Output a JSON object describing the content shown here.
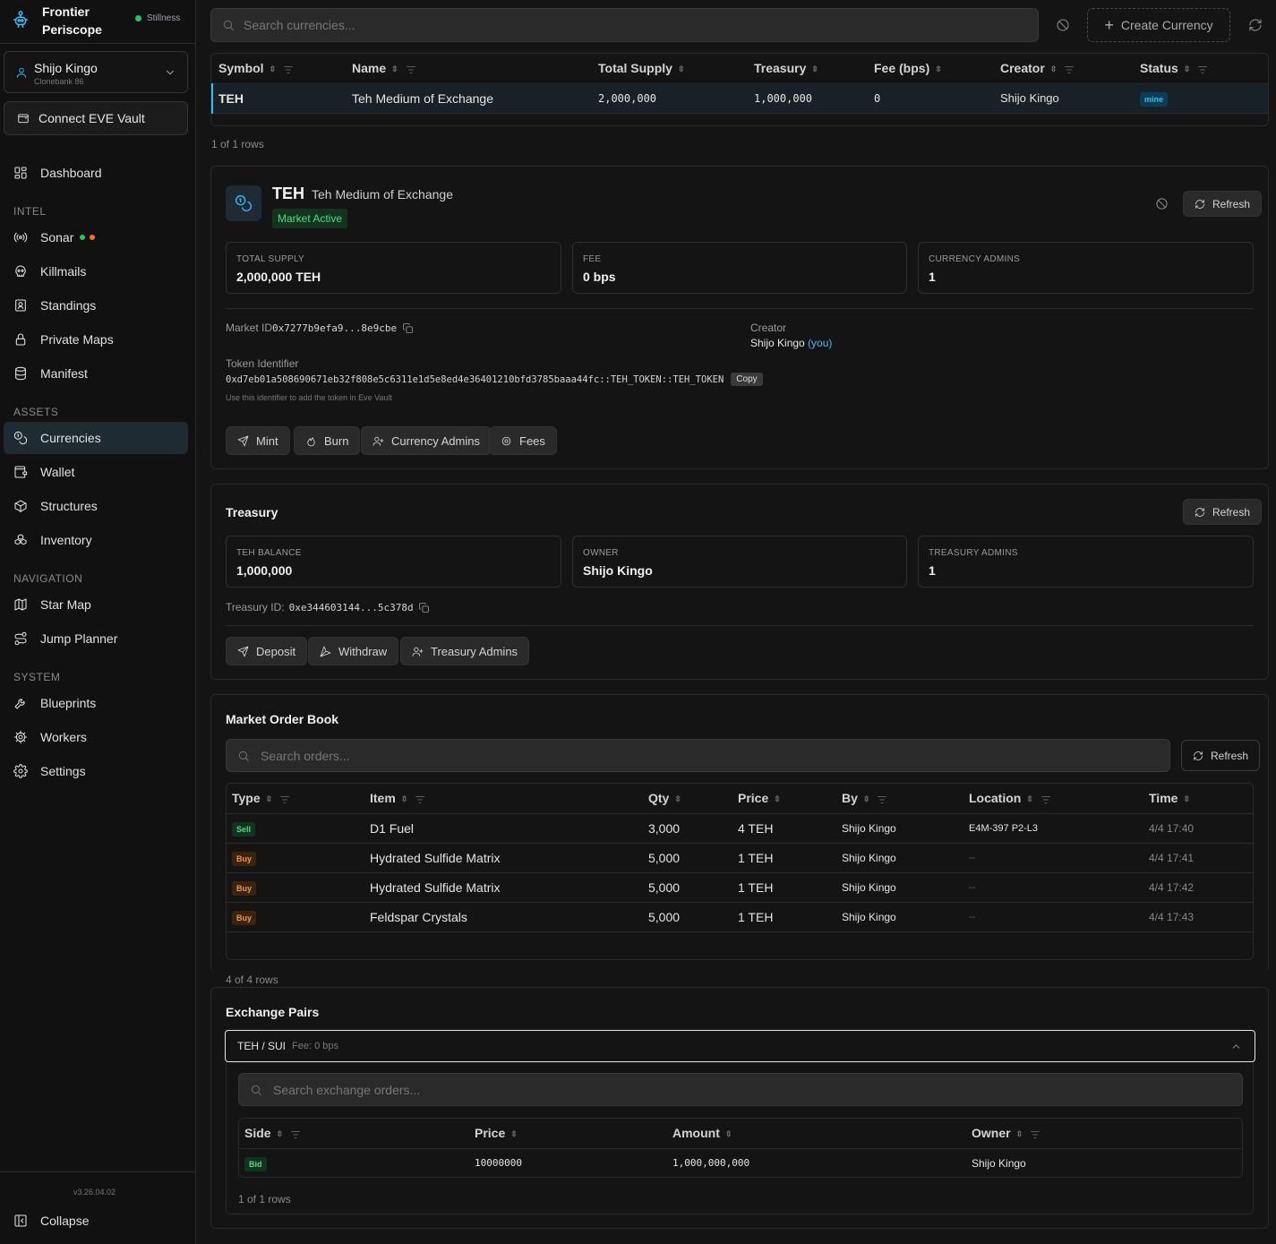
{
  "app": {
    "title": "Frontier Periscope",
    "server": "Stillness",
    "version": "v3.26.04.02"
  },
  "colors": {
    "accent": "#38bdf8",
    "green": "#22c55e",
    "orange": "#f97316",
    "sell": "#4ade80",
    "buy": "#fb923c"
  },
  "user": {
    "name": "Shijo Kingo",
    "sub": "Clonebank 86"
  },
  "vault_label": "Connect EVE Vault",
  "nav": {
    "dashboard": "Dashboard",
    "intel_header": "INTEL",
    "sonar": "Sonar",
    "killmails": "Killmails",
    "standings": "Standings",
    "private_maps": "Private Maps",
    "manifest": "Manifest",
    "assets_header": "ASSETS",
    "currencies": "Currencies",
    "wallet": "Wallet",
    "structures": "Structures",
    "inventory": "Inventory",
    "navigation_header": "NAVIGATION",
    "star_map": "Star Map",
    "jump_planner": "Jump Planner",
    "system_header": "SYSTEM",
    "blueprints": "Blueprints",
    "workers": "Workers",
    "settings": "Settings",
    "collapse": "Collapse"
  },
  "search": {
    "placeholder": "Search currencies..."
  },
  "create_label": "Create Currency",
  "currency_table": {
    "headers": {
      "symbol": "Symbol",
      "name": "Name",
      "supply": "Total Supply",
      "treasury": "Treasury",
      "fee": "Fee (bps)",
      "creator": "Creator",
      "status": "Status"
    },
    "row": {
      "symbol": "TEH",
      "name": "Teh Medium of Exchange",
      "supply": "2,000,000",
      "treasury": "1,000,000",
      "fee": "0",
      "creator": "Shijo Kingo",
      "status": "mine"
    },
    "count": "1 of 1 rows"
  },
  "detail": {
    "symbol": "TEH",
    "name": "Teh Medium of Exchange",
    "status": "Market Active",
    "refresh": "Refresh",
    "stats": {
      "supply_label": "TOTAL SUPPLY",
      "supply": "2,000,000 TEH",
      "fee_label": "FEE",
      "fee": "0 bps",
      "admins_label": "CURRENCY ADMINS",
      "admins": "1"
    },
    "market_id_label": "Market ID",
    "market_id": "0x7277b9efa9...8e9cbe",
    "creator_label": "Creator",
    "creator": "Shijo Kingo",
    "creator_you": "(you)",
    "token_label": "Token Identifier",
    "token_id": "0xd7eb01a508690671eb32f808e5c6311e1d5e8ed4e36401210bfd3785baaa44fc::TEH_TOKEN::TEH_TOKEN",
    "copy": "Copy",
    "token_hint": "Use this identifier to add the token in Eve Vault",
    "actions": {
      "mint": "Mint",
      "burn": "Burn",
      "admins": "Currency Admins",
      "fees": "Fees"
    }
  },
  "treasury": {
    "title": "Treasury",
    "refresh": "Refresh",
    "balance_label": "TEH BALANCE",
    "balance": "1,000,000",
    "owner_label": "OWNER",
    "owner": "Shijo Kingo",
    "admins_label": "TREASURY ADMINS",
    "admins": "1",
    "id_label": "Treasury ID:",
    "id": "0xe344603144...5c378d",
    "actions": {
      "deposit": "Deposit",
      "withdraw": "Withdraw",
      "admins": "Treasury Admins"
    }
  },
  "orderbook": {
    "title": "Market Order Book",
    "search_placeholder": "Search orders...",
    "refresh": "Refresh",
    "headers": {
      "type": "Type",
      "item": "Item",
      "qty": "Qty",
      "price": "Price",
      "by": "By",
      "location": "Location",
      "time": "Time"
    },
    "rows": [
      {
        "type": "Sell",
        "item": "D1 Fuel",
        "qty": "3,000",
        "price": "4 TEH",
        "by": "Shijo Kingo",
        "location": "E4M-397 P2-L3",
        "time": "4/4 17:40"
      },
      {
        "type": "Buy",
        "item": "Hydrated Sulfide Matrix",
        "qty": "5,000",
        "price": "1 TEH",
        "by": "Shijo Kingo",
        "location": "--",
        "time": "4/4 17:41"
      },
      {
        "type": "Buy",
        "item": "Hydrated Sulfide Matrix",
        "qty": "5,000",
        "price": "1 TEH",
        "by": "Shijo Kingo",
        "location": "--",
        "time": "4/4 17:42"
      },
      {
        "type": "Buy",
        "item": "Feldspar Crystals",
        "qty": "5,000",
        "price": "1 TEH",
        "by": "Shijo Kingo",
        "location": "--",
        "time": "4/4 17:43"
      }
    ],
    "count": "4 of 4 rows"
  },
  "exchange": {
    "title": "Exchange Pairs",
    "pair": "TEH / SUI",
    "pair_fee": "Fee: 0 bps",
    "search_placeholder": "Search exchange orders...",
    "headers": {
      "side": "Side",
      "price": "Price",
      "amount": "Amount",
      "owner": "Owner"
    },
    "rows": [
      {
        "side": "Bid",
        "price": "10000000",
        "amount": "1,000,000,000",
        "owner": "Shijo Kingo"
      }
    ],
    "count": "1 of 1 rows"
  }
}
